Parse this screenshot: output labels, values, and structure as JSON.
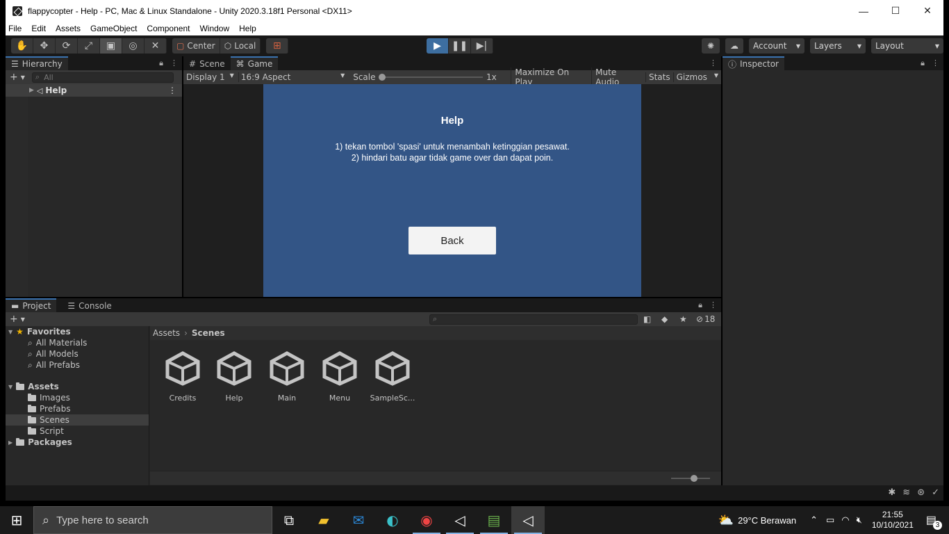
{
  "window": {
    "title": "flappycopter - Help - PC, Mac & Linux Standalone - Unity 2020.3.18f1 Personal <DX11>",
    "min": "—",
    "max": "☐",
    "close": "✕"
  },
  "menu": [
    "File",
    "Edit",
    "Assets",
    "GameObject",
    "Component",
    "Window",
    "Help"
  ],
  "toolbar": {
    "pivot": "Center",
    "space": "Local",
    "account": "Account",
    "layers": "Layers",
    "layout": "Layout"
  },
  "hierarchy": {
    "tab": "Hierarchy",
    "search_placeholder": "All",
    "root_item": "Help"
  },
  "scene_tabs": {
    "scene": "Scene",
    "game": "Game"
  },
  "game_bar": {
    "display": "Display 1",
    "aspect": "16:9 Aspect",
    "scale_label": "Scale",
    "scale_value": "1x",
    "maximize": "Maximize On Play",
    "mute": "Mute Audio",
    "stats": "Stats",
    "gizmos": "Gizmos"
  },
  "game_view": {
    "title": "Help",
    "line1": "1) tekan tombol 'spasi' untuk menambah ketinggian pesawat.",
    "line2": "2) hindari batu agar tidak game over dan dapat poin.",
    "back_label": "Back",
    "bg_color": "#335586"
  },
  "inspector": {
    "tab": "Inspector"
  },
  "project": {
    "tab": "Project",
    "console_tab": "Console",
    "hidden_count": "18",
    "breadcrumb_root": "Assets",
    "breadcrumb_current": "Scenes",
    "favorites": "Favorites",
    "fav_items": [
      "All Materials",
      "All Models",
      "All Prefabs"
    ],
    "assets_root": "Assets",
    "folders": [
      "Images",
      "Prefabs",
      "Scenes",
      "Script"
    ],
    "packages": "Packages",
    "scene_assets": [
      "Credits",
      "Help",
      "Main",
      "Menu",
      "SampleSc..."
    ]
  },
  "taskbar": {
    "search_placeholder": "Type here to search",
    "weather": "29°C  Berawan",
    "time": "21:55",
    "date": "10/10/2021",
    "notifications": "3"
  },
  "colors": {
    "accent": "#3a72b0",
    "play_active": "#3d6ea0"
  }
}
